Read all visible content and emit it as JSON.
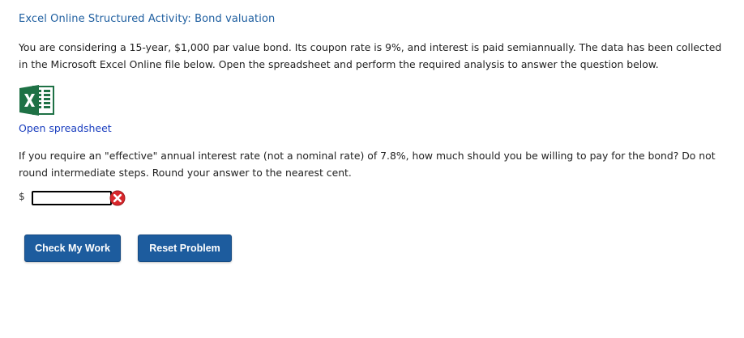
{
  "activity": {
    "title": "Excel Online Structured Activity: Bond valuation",
    "intro": "You are considering a 15-year, $1,000 par value bond. Its coupon rate is 9%, and interest is paid semiannually. The data has been collected in the Microsoft Excel Online file below. Open the spreadsheet and perform the required analysis to answer the question below.",
    "spreadsheet_icon": "excel-icon",
    "open_link_label": "Open spreadsheet"
  },
  "question": {
    "text": "If you require an \"effective\" annual interest rate (not a nominal rate) of 7.8%, how much should you be willing to pay for the bond? Do not round intermediate steps. Round your answer to the nearest cent.",
    "currency_symbol": "$",
    "answer_value": "",
    "status_icon": "incorrect-x-icon"
  },
  "buttons": {
    "check_label": "Check My Work",
    "reset_label": "Reset Problem"
  },
  "colors": {
    "title": "#1f5fa0",
    "link": "#1a3ebf",
    "button_bg": "#1d5c9e",
    "excel_green": "#1e7145",
    "error_red": "#d9262b"
  }
}
